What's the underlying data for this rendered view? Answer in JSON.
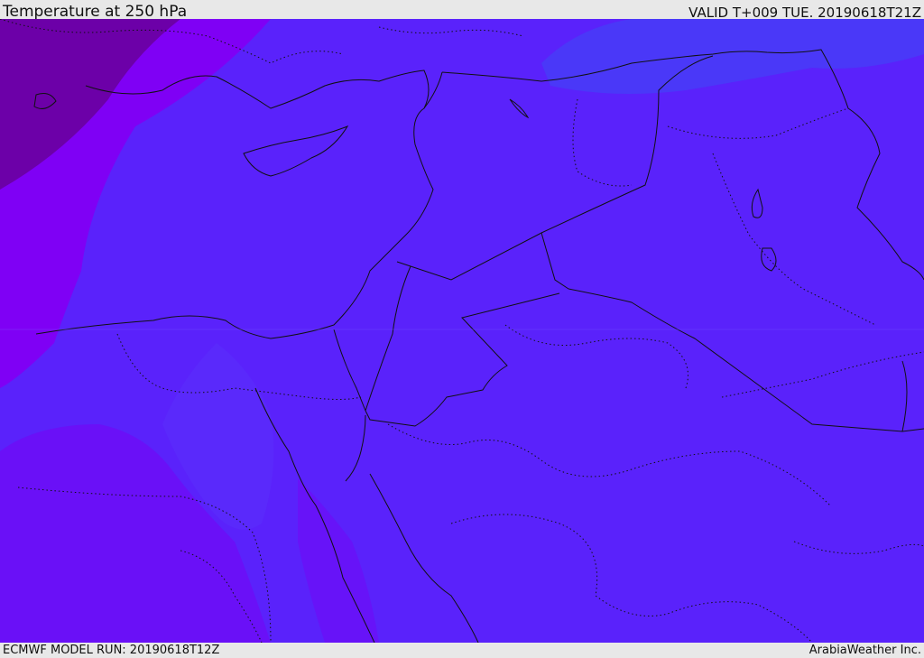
{
  "header": {
    "title": "Temperature at 250 hPa",
    "valid": "VALID T+009 TUE. 20190618T21Z"
  },
  "footer": {
    "model_run": "ECMWF MODEL RUN: 20190618T12Z",
    "credit": "ArabiaWeather Inc."
  },
  "map": {
    "field": "temperature",
    "level": "250 hPa",
    "colors": {
      "deepest": "#6c00a8",
      "deep": "#7f00f5",
      "violet": "#6a10f7",
      "blue_violet": "#5a22fb",
      "blue": "#4a38f8",
      "boundary_line": "#111111"
    }
  }
}
